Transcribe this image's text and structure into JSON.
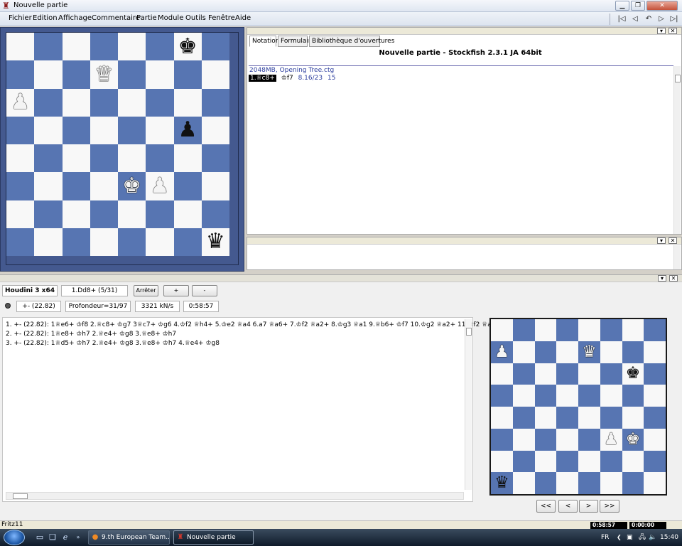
{
  "window": {
    "title": "Nouvelle partie"
  },
  "menu": [
    "Fichier",
    "Edition",
    "Affichage",
    "Commentaire",
    "Partie",
    "Module",
    "Outils",
    "Fenêtre",
    "Aide"
  ],
  "nav_icons": [
    "first-move-icon",
    "prev-move-icon",
    "takeback-icon",
    "next-move-icon",
    "last-move-icon"
  ],
  "colors": {
    "light_square": "#f8f8f8",
    "dark_square": "#5775b2",
    "board_frame": "#44598f"
  },
  "main_board": {
    "pieces": [
      {
        "square": "g8",
        "piece": "king",
        "color": "black",
        "glyph": "♚"
      },
      {
        "square": "d7",
        "piece": "queen",
        "color": "white",
        "glyph": "♕"
      },
      {
        "square": "a6",
        "piece": "pawn",
        "color": "white",
        "glyph": "♙"
      },
      {
        "square": "g5",
        "piece": "pawn",
        "color": "black",
        "glyph": "♟"
      },
      {
        "square": "e3",
        "piece": "king",
        "color": "white",
        "glyph": "♔"
      },
      {
        "square": "f3",
        "piece": "pawn",
        "color": "white",
        "glyph": "♙"
      },
      {
        "square": "h1",
        "piece": "queen",
        "color": "black",
        "glyph": "♛"
      }
    ]
  },
  "notation": {
    "tabs": [
      "Notation",
      "Formulaire",
      "Bibliothèque d'ouvertures"
    ],
    "active_tab": 0,
    "game_title": "Nouvelle partie - Stockfish 2.3.1 JA 64bit",
    "tree_info": "2048MB, Opening Tree.ctg",
    "move": "1.♕c8+",
    "move_rest": "♔f7",
    "move_eval": "8.16/23",
    "move_count": "15"
  },
  "engine": {
    "name": "Houdini 3 x64",
    "best_move": "1.Dd8+ (5/31)",
    "stop_label": "Arrêter",
    "plus_label": "+",
    "minus_label": "-",
    "eval": "+- (22.82)",
    "depth": "Profondeur=31/97",
    "speed": "3321 kN/s",
    "time": "0:58:57",
    "lines": [
      "1. +- (22.82): 1♕e6+ ♔f8 2.♕c8+ ♔g7 3♕c7+ ♔g6 4.♔f2 ♕h4+ 5.♔e2 ♕a4 6.a7 ♕a6+ 7.♔f2 ♕a2+ 8.♔g3 ♕a1 9.♕b6+ ♔f7 10.♔g2 ♕a2+ 11.♕f2 ♕a",
      "2. +- (22.82): 1♕e8+ ♔h7 2.♕e4+ ♔g8 3.♕e8+ ♔h7",
      "3. +- (22.82): 1♕d5+ ♔h7 2.♕e4+ ♔g8 3.♕e8+ ♔h7 4.♕e4+ ♔g8"
    ]
  },
  "small_board": {
    "pieces": [
      {
        "square": "a7",
        "piece": "pawn",
        "color": "white",
        "glyph": "♙"
      },
      {
        "square": "e7",
        "piece": "queen",
        "color": "white",
        "glyph": "♕"
      },
      {
        "square": "g6",
        "piece": "king",
        "color": "black",
        "glyph": "♚"
      },
      {
        "square": "f3",
        "piece": "pawn",
        "color": "white",
        "glyph": "♙"
      },
      {
        "square": "g3",
        "piece": "king",
        "color": "white",
        "glyph": "♔"
      },
      {
        "square": "a1",
        "piece": "queen",
        "color": "black",
        "glyph": "♛"
      }
    ],
    "nav": [
      "<<",
      "<",
      ">",
      ">>"
    ]
  },
  "status": {
    "app": "Fritz11",
    "clock_white": "0:58:57",
    "clock_black": "0:00:00"
  },
  "taskbar": {
    "quicklaunch": [
      "show-desktop-icon",
      "switch-windows-icon",
      "internet-explorer-icon"
    ],
    "tasks": [
      {
        "label": "9.th European Team...",
        "icon": "firefox-icon"
      },
      {
        "label": "Nouvelle partie",
        "icon": "fritz-icon"
      }
    ],
    "lang": "FR",
    "time": "15:40"
  }
}
